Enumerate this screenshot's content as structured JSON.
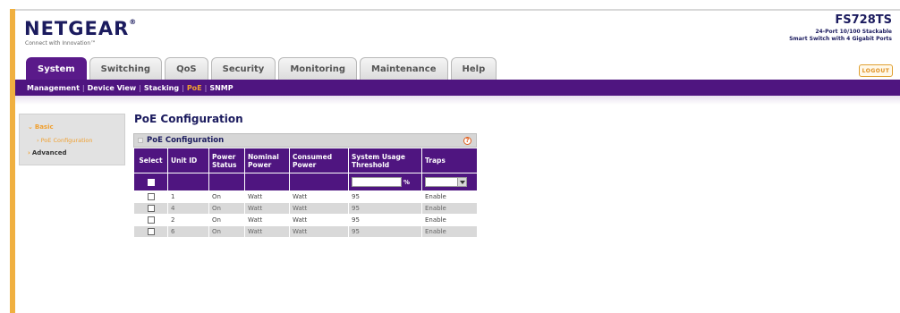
{
  "header": {
    "brand": "NETGEAR",
    "registered": "®",
    "tagline": "Connect with Innovation™",
    "model": "FS728TS",
    "model_desc_line1": "24-Port 10/100 Stackable",
    "model_desc_line2": "Smart Switch with 4 Gigabit Ports",
    "logout_label": "LOGOUT"
  },
  "tabs": [
    {
      "label": "System",
      "active": true
    },
    {
      "label": "Switching",
      "active": false
    },
    {
      "label": "QoS",
      "active": false
    },
    {
      "label": "Security",
      "active": false
    },
    {
      "label": "Monitoring",
      "active": false
    },
    {
      "label": "Maintenance",
      "active": false
    },
    {
      "label": "Help",
      "active": false
    }
  ],
  "subnav": [
    "Management",
    "Device View",
    "Stacking",
    "PoE",
    "SNMP"
  ],
  "subnav_active": "PoE",
  "sidebar": {
    "basic": "Basic",
    "poe_config": "PoE Configuration",
    "advanced": "Advanced"
  },
  "page_title": "PoE Configuration",
  "panel": {
    "title": "PoE Configuration",
    "help_symbol": "?",
    "columns": [
      "Select",
      "Unit ID",
      "Power Status",
      "Nominal Power",
      "Consumed Power",
      "System Usage Threshold",
      "Traps"
    ],
    "threshold_unit": "%",
    "rows": [
      {
        "unit_id": "1",
        "power_status": "On",
        "nominal_power": "Watt",
        "consumed_power": "Watt",
        "threshold": "95",
        "traps": "Enable"
      },
      {
        "unit_id": "4",
        "power_status": "On",
        "nominal_power": "Watt",
        "consumed_power": "Watt",
        "threshold": "95",
        "traps": "Enable"
      },
      {
        "unit_id": "2",
        "power_status": "On",
        "nominal_power": "Watt",
        "consumed_power": "Watt",
        "threshold": "95",
        "traps": "Enable"
      },
      {
        "unit_id": "6",
        "power_status": "On",
        "nominal_power": "Watt",
        "consumed_power": "Watt",
        "threshold": "95",
        "traps": "Enable"
      }
    ]
  },
  "colors": {
    "nav_purple": "#4f1580",
    "accent_orange": "#f0a030",
    "title_navy": "#1b1b5e"
  }
}
